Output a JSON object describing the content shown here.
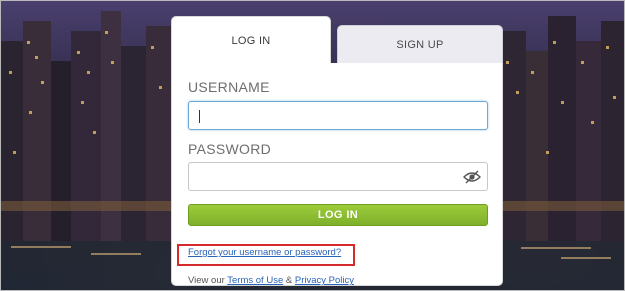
{
  "tabs": {
    "login": "LOG IN",
    "signup": "SIGN UP"
  },
  "form": {
    "username_label": "USERNAME",
    "username_value": "",
    "password_label": "PASSWORD",
    "password_value": "",
    "login_button": "LOG IN",
    "forgot_link": "Forgot your username or password?",
    "footer_prefix": "View our ",
    "terms_link": "Terms of Use",
    "footer_amp": " & ",
    "privacy_link": "Privacy Policy"
  },
  "icons": {
    "password_toggle": "eye-slash-icon"
  },
  "colors": {
    "login_button": "#8dbd33",
    "link": "#2a64b8",
    "highlight_box": "#d62a2a",
    "input_focus": "#6ea9d6"
  }
}
